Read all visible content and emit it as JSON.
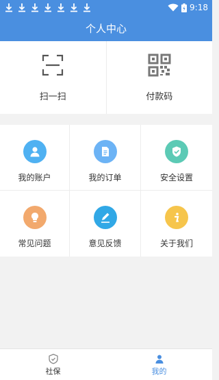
{
  "status_bar": {
    "download_count": 7,
    "time": "9:18"
  },
  "header": {
    "title": "个人中心"
  },
  "top_actions": [
    {
      "label": "扫一扫",
      "icon": "scan-icon"
    },
    {
      "label": "付款码",
      "icon": "qr-code-icon"
    }
  ],
  "grid": [
    {
      "label": "我的账户",
      "icon": "user-icon",
      "color": "#4fb1f2"
    },
    {
      "label": "我的订单",
      "icon": "document-icon",
      "color": "#6cb3f5"
    },
    {
      "label": "安全设置",
      "icon": "shield-icon",
      "color": "#5ccab5"
    },
    {
      "label": "常见问题",
      "icon": "lightbulb-icon",
      "color": "#f2a96d"
    },
    {
      "label": "意见反馈",
      "icon": "pen-icon",
      "color": "#31a8e6"
    },
    {
      "label": "关于我们",
      "icon": "info-icon",
      "color": "#f6c54c"
    }
  ],
  "bottom_nav": [
    {
      "label": "社保",
      "icon": "social-security-icon",
      "active": false
    },
    {
      "label": "我的",
      "icon": "profile-icon",
      "active": true
    }
  ],
  "colors": {
    "primary": "#4a8fe0",
    "background": "#f2f2f2"
  }
}
